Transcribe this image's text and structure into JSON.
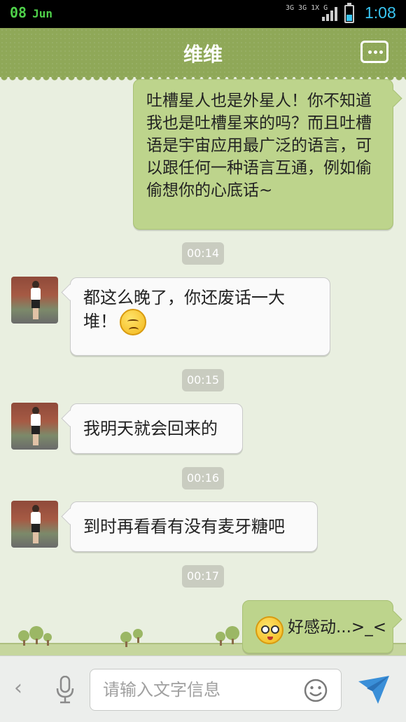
{
  "status_bar": {
    "date_day": "08",
    "date_month": "Jun",
    "network_label": "3G 3G 1X G",
    "time": "1:08",
    "battery_icon": "battery-icon",
    "signal_icon": "signal-icon"
  },
  "header": {
    "title": "维维",
    "menu_icon": "more-menu-icon"
  },
  "messages": [
    {
      "side": "out",
      "text": "吐槽星人也是外星人！你不知道我也是吐槽星来的吗？而且吐槽语是宇宙应用最广泛的语言，可以跟任何一种语言互通，例如偷偷想你的心底话~"
    },
    {
      "timestamp": "00:14"
    },
    {
      "side": "in",
      "text": "都这么晚了，你还废话一大堆！",
      "emoji": "sad-face-emoji"
    },
    {
      "timestamp": "00:15"
    },
    {
      "side": "in",
      "text": "我明天就会回来的"
    },
    {
      "timestamp": "00:16"
    },
    {
      "side": "in",
      "text": "到时再看看有没有麦牙糖吧"
    },
    {
      "timestamp": "00:17"
    },
    {
      "side": "out",
      "text": "好感动...>_<",
      "emoji": "teary-face-emoji"
    }
  ],
  "input_bar": {
    "placeholder": "请输入文字信息",
    "back_icon": "chevron-left-icon",
    "voice_icon": "microphone-icon",
    "emoji_icon": "smiley-icon",
    "send_icon": "send-icon"
  },
  "colors": {
    "header_green": "#8fa858",
    "outgoing_bubble": "#bdd48c",
    "incoming_bubble": "#fafafa",
    "background": "#e9efe0",
    "time_blue": "#39c5f2"
  }
}
